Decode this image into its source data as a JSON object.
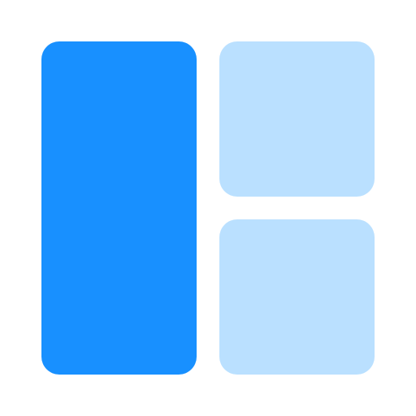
{
  "icon": {
    "name": "layout-panels-icon",
    "colors": {
      "primary": "#1890FF",
      "secondary": "#BAE0FF",
      "background": "#FFFFFF"
    }
  }
}
